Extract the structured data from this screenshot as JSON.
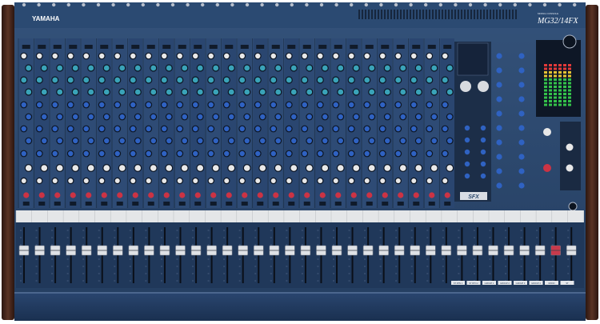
{
  "mixer": {
    "brand": "YAMAHA",
    "model": "MG32/14FX",
    "model_sub": "MIXING CONSOLE",
    "fx_logo": "SFX",
    "mono_channel_count": 24,
    "stereo_channel_count": 4,
    "group_fader_count": 5,
    "fader_labels": [
      "ST RTN 1",
      "ST RTN 2",
      "GROUP 1",
      "GROUP 2",
      "GROUP 3",
      "GROUP 4",
      "MONO",
      "ST"
    ]
  },
  "colors": {
    "panel_blue": "#2d4a6e",
    "panel_dark": "#1b2f4b",
    "wood": "#4a2a1e",
    "knob_cyan": "#3aa3b8",
    "knob_blue": "#2f62c2",
    "knob_white": "#e8e8e8",
    "knob_red": "#cc3344",
    "meter_green": "#34c24a"
  }
}
